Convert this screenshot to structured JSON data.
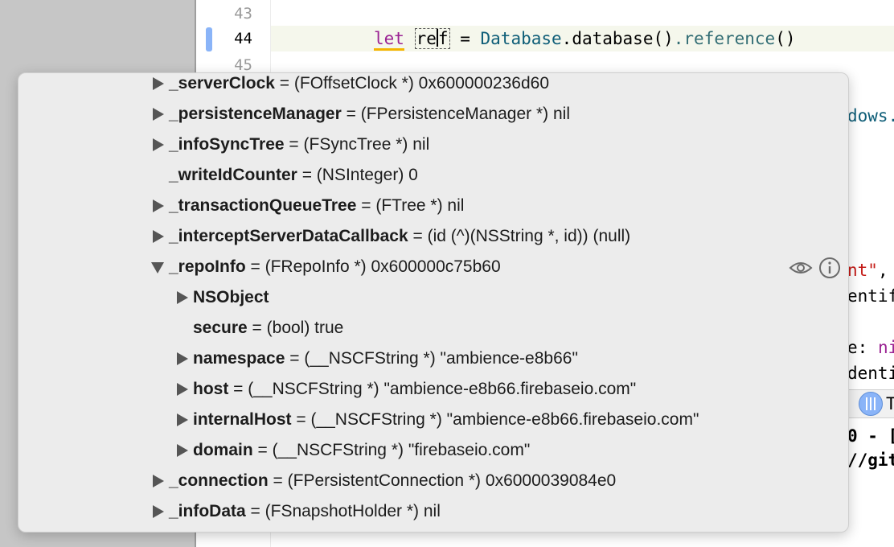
{
  "editor": {
    "line_numbers": [
      "43",
      "44",
      "45"
    ],
    "code_line": {
      "keyword": "let",
      "identifier_a": "re",
      "identifier_b": "f",
      "equals": "=",
      "type_name": "Database",
      "call1": ".database",
      "parens1": "()",
      "call2": ".reference",
      "parens2": "()"
    },
    "right_fragments": {
      "frag1": "dows.",
      "frag2_str": "nt\"",
      "frag2_rest": ",",
      "frag3": "entif",
      "frag4_a": "e: ",
      "frag4_b": "ni",
      "frag5": "denti",
      "frag6": "T",
      "frag7": "0 - [",
      "frag8": "//git"
    }
  },
  "popover": {
    "rows": [
      {
        "name": "_serverClock",
        "value": " = (FOffsetClock *) 0x600000236d60"
      },
      {
        "name": "_persistenceManager",
        "value": " = (FPersistenceManager *) nil"
      },
      {
        "name": "_infoSyncTree",
        "value": " = (FSyncTree *) nil"
      },
      {
        "name": "_writeIdCounter",
        "value": " = (NSInteger) 0"
      },
      {
        "name": "_transactionQueueTree",
        "value": " = (FTree *) nil"
      },
      {
        "name": "_interceptServerDataCallback",
        "value": " = (id (^)(NSString *, id)) (null)"
      },
      {
        "name": "_repoInfo",
        "value": " = (FRepoInfo *) 0x600000c75b60"
      },
      {
        "name": "NSObject",
        "value": ""
      },
      {
        "name": "secure",
        "value": " = (bool) true"
      },
      {
        "name": "namespace",
        "value": " = (__NSCFString *) \"ambience-e8b66\""
      },
      {
        "name": "host",
        "value": " = (__NSCFString *) \"ambience-e8b66.firebaseio.com\""
      },
      {
        "name": "internalHost",
        "value": " = (__NSCFString *) \"ambience-e8b66.firebaseio.com\""
      },
      {
        "name": "domain",
        "value": " = (__NSCFString *) \"firebaseio.com\""
      },
      {
        "name": "_connection",
        "value": " = (FPersistentConnection *) 0x6000039084e0"
      },
      {
        "name": "_infoData",
        "value": " = (FSnapshotHolder *) nil"
      }
    ],
    "icons": [
      "eye-icon",
      "info-icon"
    ]
  },
  "colors": {
    "keyword": "#9b2393",
    "type": "#0f5e78",
    "string": "#c41a16",
    "breakpoint": "#8ab4f8"
  }
}
